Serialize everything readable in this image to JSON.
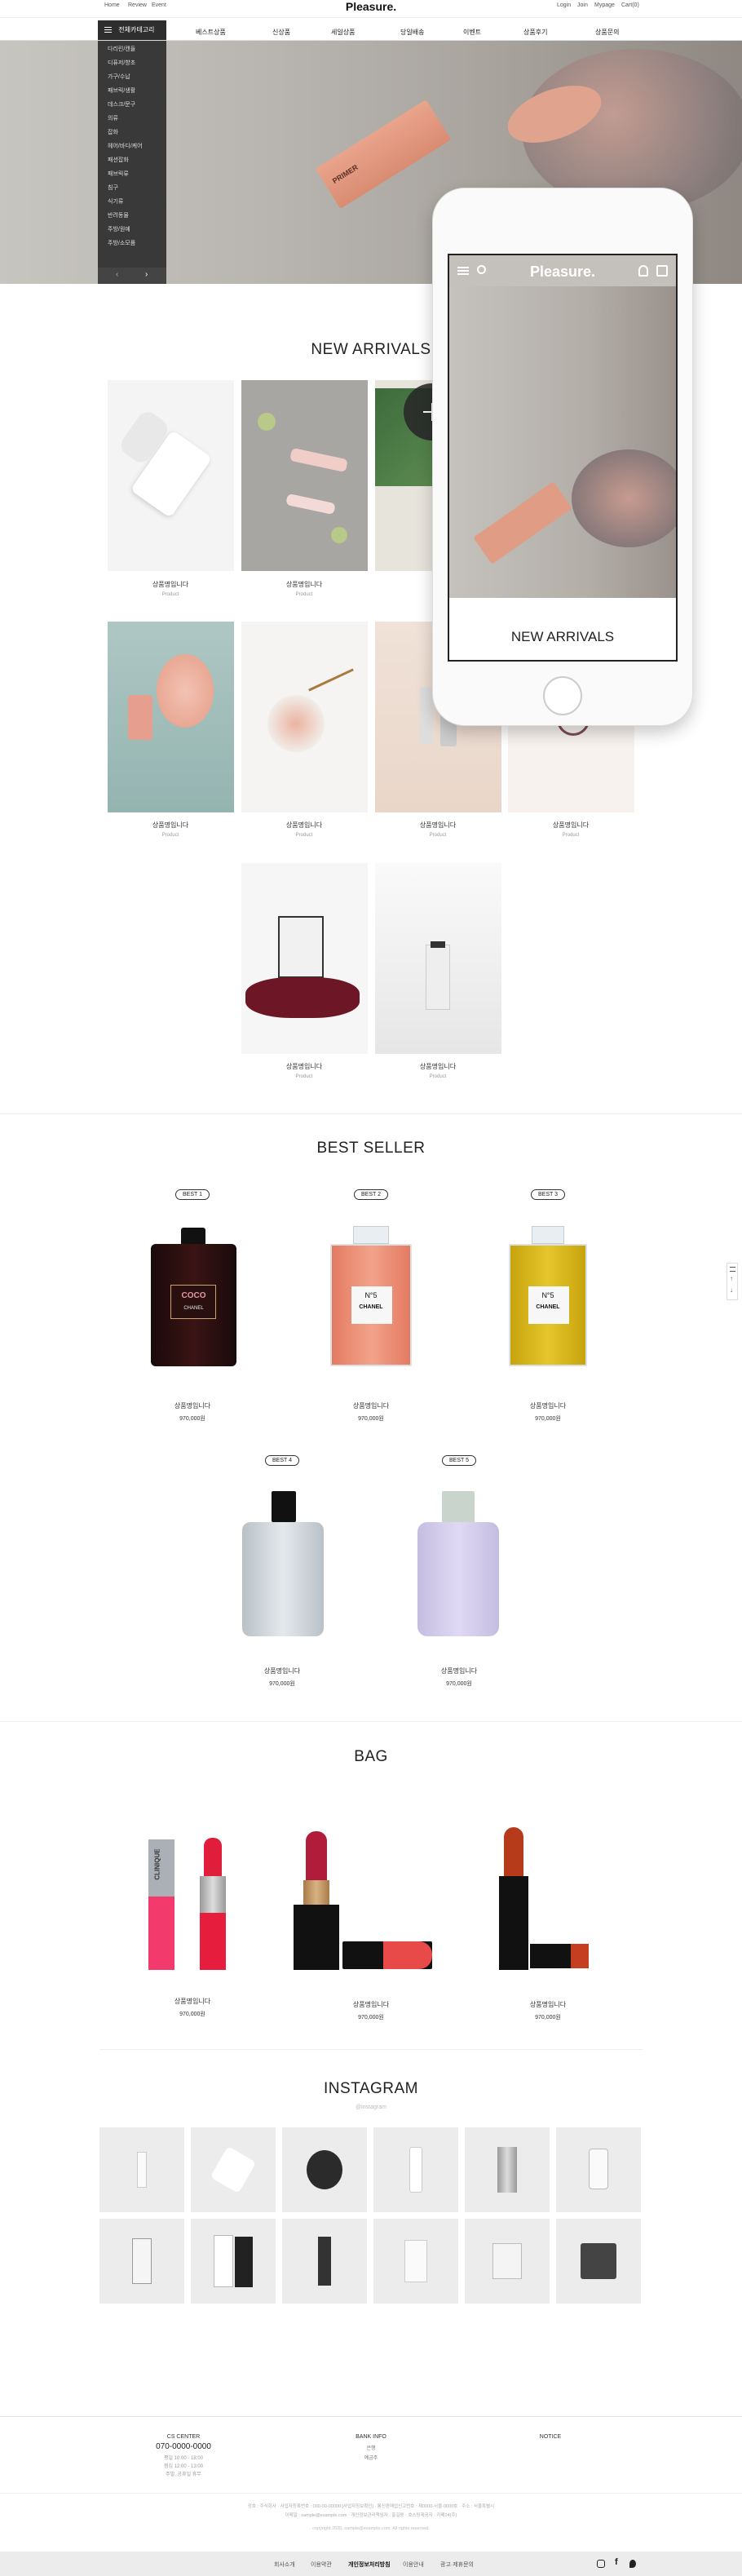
{
  "topbar": {
    "left_links": [
      "Home",
      "Review",
      "Event"
    ],
    "logo": "Pleasure.",
    "right_links": [
      "Login",
      "Join",
      "Mypage",
      "Cart(0)"
    ]
  },
  "nav": {
    "menu_button": "전체카테고리",
    "items": [
      "베스트상품",
      "신상품",
      "세일상품",
      "당일배송",
      "이벤트",
      "상품후기",
      "상품문의"
    ]
  },
  "category_menu": {
    "items": [
      "다리린/캔들",
      "디퓨저/향초",
      "가구/수납",
      "패브릭/생활",
      "데스크/문구",
      "의류",
      "잡화",
      "헤어/바디/케어",
      "패션잡화",
      "패브릭류",
      "침구",
      "식기류",
      "반려동물",
      "주방/원예",
      "주방/소모품"
    ]
  },
  "hero": {
    "accent": "#e8a894"
  },
  "mobile_preview": {
    "logo": "Pleasure.",
    "section_title": "NEW ARRIVALS"
  },
  "new_arrivals": {
    "title": "NEW ARRIVALS",
    "items": [
      {
        "name": "상품명입니다",
        "sub": "Product"
      },
      {
        "name": "상품명입니다",
        "sub": "Product"
      },
      {
        "name": "상품명입니다",
        "sub": "Product"
      },
      {
        "name": "상품명입니다",
        "sub": "Product"
      },
      {
        "name": "상품명입니다",
        "sub": "Product"
      },
      {
        "name": "상품명입니다",
        "sub": "Product"
      },
      {
        "name": "상품명입니다",
        "sub": "Product"
      },
      {
        "name": "상품명입니다",
        "sub": "Product"
      },
      {
        "name": "상품명입니다",
        "sub": "Product"
      },
      {
        "name": "상품명입니다",
        "sub": "Product"
      }
    ]
  },
  "best_seller": {
    "title": "BEST SELLER",
    "items": [
      {
        "badge": "BEST 1",
        "name": "상품명입니다",
        "price": "970,000원"
      },
      {
        "badge": "BEST 2",
        "name": "상품명입니다",
        "price": "970,000원"
      },
      {
        "badge": "BEST 3",
        "name": "상품명입니다",
        "price": "970,000원"
      },
      {
        "badge": "BEST 4",
        "name": "상품명입니다",
        "price": "970,000원"
      },
      {
        "badge": "BEST 5",
        "name": "상품명입니다",
        "price": "970,000원"
      }
    ],
    "bottle_labels": [
      "COCO",
      "N°5",
      "N°5"
    ],
    "bottle_sub": [
      "CHANEL",
      "CHANEL",
      "CHANEL"
    ]
  },
  "bag": {
    "title": "BAG",
    "items": [
      {
        "name": "상품명입니다",
        "price": "970,000원"
      },
      {
        "name": "상품명입니다",
        "price": "970,000원"
      },
      {
        "name": "상품명입니다",
        "price": "970,000원"
      }
    ],
    "brand": "CLINIQUE"
  },
  "instagram": {
    "title": "INSTAGRAM",
    "handle": "@instagram"
  },
  "side_tools": [
    "↑",
    "↓"
  ],
  "footer": {
    "cs_title": "CS CENTER",
    "cs_phone": "070-0000-0000",
    "cs_lines": [
      "평일 10:00 - 18:00",
      "점심 12:00 - 13:00",
      "주말, 공휴일 휴무"
    ],
    "bank_title": "BANK INFO",
    "bank_lines": [
      "은행",
      "예금주"
    ],
    "notice_title": "NOTICE",
    "company_line1": "상호 : 주식회사 · 사업자등록번호 : 000-00-00000 [사업자정보확인] · 통신판매업신고번호 : 제0000-서울-0000호 · 주소 : 서울특별시",
    "company_line2": "이메일 : sample@example.com · 개인정보관리책임자 : 홍길동 · 호스팅제공자 : 카페24(주)",
    "copyright": "copyright 2020. sample@example.com. All rights reserved.",
    "bottom_links": [
      "회사소개",
      "이용약관",
      "개인정보처리방침",
      "이용안내",
      "광고·제휴문의"
    ]
  }
}
